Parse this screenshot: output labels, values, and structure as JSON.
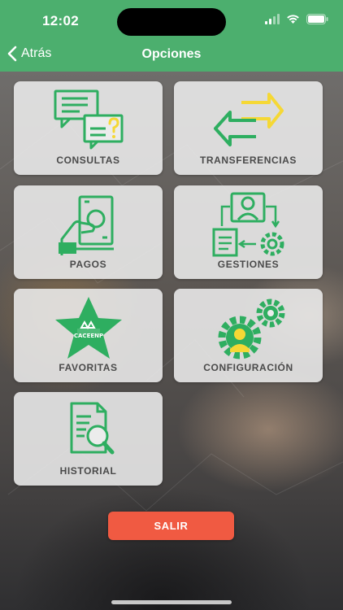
{
  "status_bar": {
    "time": "12:02"
  },
  "nav": {
    "back_label": "Atrás",
    "title": "Opciones"
  },
  "tiles": {
    "consultas": "CONSULTAS",
    "transferencias": "TRANSFERENCIAS",
    "pagos": "PAGOS",
    "gestiones": "GESTIONES",
    "favoritas": "FAVORITAS",
    "configuracion": "CONFIGURACIÓN",
    "historial": "HISTORIAL"
  },
  "favoritas_badge": "CACEENP",
  "exit_button": "SALIR",
  "colors": {
    "brand_green": "#4caf6e",
    "icon_green": "#2eae60",
    "accent_yellow": "#f5d835",
    "exit_red": "#f05a42"
  }
}
